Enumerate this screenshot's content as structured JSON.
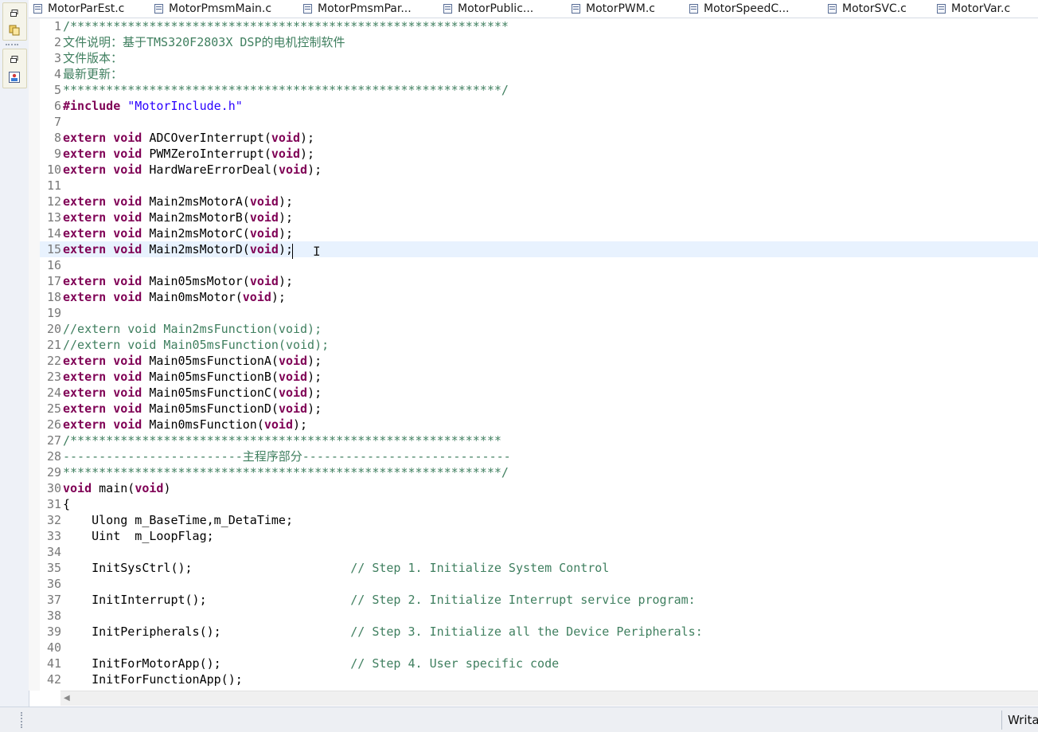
{
  "tabs": [
    {
      "label": "MotorParEst.c"
    },
    {
      "label": "MotorPmsmMain.c"
    },
    {
      "label": "MotorPmsmPar..."
    },
    {
      "label": "MotorPublic..."
    },
    {
      "label": "MotorPWM.c"
    },
    {
      "label": "MotorSpeedC..."
    },
    {
      "label": "MotorSVC.c"
    },
    {
      "label": "MotorVar.c"
    }
  ],
  "toolbar_icons": [
    "restore-icon",
    "copy-files-icon",
    "restore-icon",
    "image-icon"
  ],
  "editor": {
    "current_line": 15,
    "lines": [
      {
        "n": "1",
        "segs": [
          {
            "t": "/*************************************************************",
            "c": "cm"
          }
        ]
      },
      {
        "n": "2",
        "segs": [
          {
            "t": "文件说明：基于TMS320F2803X DSP的电机控制软件",
            "c": "cm"
          }
        ]
      },
      {
        "n": "3",
        "segs": [
          {
            "t": "文件版本：",
            "c": "cm"
          }
        ]
      },
      {
        "n": "4",
        "segs": [
          {
            "t": "最新更新：",
            "c": "cm"
          }
        ]
      },
      {
        "n": "5",
        "segs": [
          {
            "t": "*************************************************************/",
            "c": "cm"
          }
        ]
      },
      {
        "n": "6",
        "segs": [
          {
            "t": "#include",
            "c": "kw"
          },
          {
            "t": " ",
            "c": "pl"
          },
          {
            "t": "\"MotorInclude.h\"",
            "c": "str"
          }
        ]
      },
      {
        "n": "7",
        "segs": []
      },
      {
        "n": "8",
        "segs": [
          {
            "t": "extern",
            "c": "kw"
          },
          {
            "t": " ",
            "c": "pl"
          },
          {
            "t": "void",
            "c": "kw"
          },
          {
            "t": " ADCOverInterrupt(",
            "c": "pl"
          },
          {
            "t": "void",
            "c": "kw"
          },
          {
            "t": ");",
            "c": "pl"
          }
        ]
      },
      {
        "n": "9",
        "segs": [
          {
            "t": "extern",
            "c": "kw"
          },
          {
            "t": " ",
            "c": "pl"
          },
          {
            "t": "void",
            "c": "kw"
          },
          {
            "t": " PWMZeroInterrupt(",
            "c": "pl"
          },
          {
            "t": "void",
            "c": "kw"
          },
          {
            "t": ");",
            "c": "pl"
          }
        ]
      },
      {
        "n": "10",
        "segs": [
          {
            "t": "extern",
            "c": "kw"
          },
          {
            "t": " ",
            "c": "pl"
          },
          {
            "t": "void",
            "c": "kw"
          },
          {
            "t": " HardWareErrorDeal(",
            "c": "pl"
          },
          {
            "t": "void",
            "c": "kw"
          },
          {
            "t": ");",
            "c": "pl"
          }
        ]
      },
      {
        "n": "11",
        "segs": []
      },
      {
        "n": "12",
        "segs": [
          {
            "t": "extern",
            "c": "kw"
          },
          {
            "t": " ",
            "c": "pl"
          },
          {
            "t": "void",
            "c": "kw"
          },
          {
            "t": " Main2msMotorA(",
            "c": "pl"
          },
          {
            "t": "void",
            "c": "kw"
          },
          {
            "t": ");",
            "c": "pl"
          }
        ]
      },
      {
        "n": "13",
        "segs": [
          {
            "t": "extern",
            "c": "kw"
          },
          {
            "t": " ",
            "c": "pl"
          },
          {
            "t": "void",
            "c": "kw"
          },
          {
            "t": " Main2msMotorB(",
            "c": "pl"
          },
          {
            "t": "void",
            "c": "kw"
          },
          {
            "t": ");",
            "c": "pl"
          }
        ]
      },
      {
        "n": "14",
        "segs": [
          {
            "t": "extern",
            "c": "kw"
          },
          {
            "t": " ",
            "c": "pl"
          },
          {
            "t": "void",
            "c": "kw"
          },
          {
            "t": " Main2msMotorC(",
            "c": "pl"
          },
          {
            "t": "void",
            "c": "kw"
          },
          {
            "t": ");",
            "c": "pl"
          }
        ]
      },
      {
        "n": "15",
        "segs": [
          {
            "t": "extern",
            "c": "kw"
          },
          {
            "t": " ",
            "c": "pl"
          },
          {
            "t": "void",
            "c": "kw"
          },
          {
            "t": " Main2msMotorD(",
            "c": "pl"
          },
          {
            "t": "void",
            "c": "kw"
          },
          {
            "t": ");",
            "c": "pl"
          }
        ]
      },
      {
        "n": "16",
        "segs": []
      },
      {
        "n": "17",
        "segs": [
          {
            "t": "extern",
            "c": "kw"
          },
          {
            "t": " ",
            "c": "pl"
          },
          {
            "t": "void",
            "c": "kw"
          },
          {
            "t": " Main05msMotor(",
            "c": "pl"
          },
          {
            "t": "void",
            "c": "kw"
          },
          {
            "t": ");",
            "c": "pl"
          }
        ]
      },
      {
        "n": "18",
        "segs": [
          {
            "t": "extern",
            "c": "kw"
          },
          {
            "t": " ",
            "c": "pl"
          },
          {
            "t": "void",
            "c": "kw"
          },
          {
            "t": " Main0msMotor(",
            "c": "pl"
          },
          {
            "t": "void",
            "c": "kw"
          },
          {
            "t": ");",
            "c": "pl"
          }
        ]
      },
      {
        "n": "19",
        "segs": []
      },
      {
        "n": "20",
        "segs": [
          {
            "t": "//extern void Main2msFunction(void);",
            "c": "cm"
          }
        ]
      },
      {
        "n": "21",
        "segs": [
          {
            "t": "//extern void Main05msFunction(void);",
            "c": "cm"
          }
        ]
      },
      {
        "n": "22",
        "segs": [
          {
            "t": "extern",
            "c": "kw"
          },
          {
            "t": " ",
            "c": "pl"
          },
          {
            "t": "void",
            "c": "kw"
          },
          {
            "t": " Main05msFunctionA(",
            "c": "pl"
          },
          {
            "t": "void",
            "c": "kw"
          },
          {
            "t": ");",
            "c": "pl"
          }
        ]
      },
      {
        "n": "23",
        "segs": [
          {
            "t": "extern",
            "c": "kw"
          },
          {
            "t": " ",
            "c": "pl"
          },
          {
            "t": "void",
            "c": "kw"
          },
          {
            "t": " Main05msFunctionB(",
            "c": "pl"
          },
          {
            "t": "void",
            "c": "kw"
          },
          {
            "t": ");",
            "c": "pl"
          }
        ]
      },
      {
        "n": "24",
        "segs": [
          {
            "t": "extern",
            "c": "kw"
          },
          {
            "t": " ",
            "c": "pl"
          },
          {
            "t": "void",
            "c": "kw"
          },
          {
            "t": " Main05msFunctionC(",
            "c": "pl"
          },
          {
            "t": "void",
            "c": "kw"
          },
          {
            "t": ");",
            "c": "pl"
          }
        ]
      },
      {
        "n": "25",
        "segs": [
          {
            "t": "extern",
            "c": "kw"
          },
          {
            "t": " ",
            "c": "pl"
          },
          {
            "t": "void",
            "c": "kw"
          },
          {
            "t": " Main05msFunctionD(",
            "c": "pl"
          },
          {
            "t": "void",
            "c": "kw"
          },
          {
            "t": ");",
            "c": "pl"
          }
        ]
      },
      {
        "n": "26",
        "segs": [
          {
            "t": "extern",
            "c": "kw"
          },
          {
            "t": " ",
            "c": "pl"
          },
          {
            "t": "void",
            "c": "kw"
          },
          {
            "t": " Main0msFunction(",
            "c": "pl"
          },
          {
            "t": "void",
            "c": "kw"
          },
          {
            "t": ");",
            "c": "pl"
          }
        ]
      },
      {
        "n": "27",
        "segs": [
          {
            "t": "/************************************************************",
            "c": "cm"
          }
        ]
      },
      {
        "n": "28",
        "segs": [
          {
            "t": "-------------------------主程序部分-----------------------------",
            "c": "cm"
          }
        ]
      },
      {
        "n": "29",
        "segs": [
          {
            "t": "*************************************************************/",
            "c": "cm"
          }
        ]
      },
      {
        "n": "30",
        "segs": [
          {
            "t": "void",
            "c": "kw"
          },
          {
            "t": " main(",
            "c": "pl"
          },
          {
            "t": "void",
            "c": "kw"
          },
          {
            "t": ")",
            "c": "pl"
          }
        ]
      },
      {
        "n": "31",
        "segs": [
          {
            "t": "{",
            "c": "pl"
          }
        ]
      },
      {
        "n": "32",
        "segs": [
          {
            "t": "    Ulong m_BaseTime,m_DetaTime;",
            "c": "pl"
          }
        ]
      },
      {
        "n": "33",
        "segs": [
          {
            "t": "    Uint  m_LoopFlag;",
            "c": "pl"
          }
        ]
      },
      {
        "n": "34",
        "segs": []
      },
      {
        "n": "35",
        "segs": [
          {
            "t": "    InitSysCtrl();                      ",
            "c": "pl"
          },
          {
            "t": "// Step 1. Initialize System Control",
            "c": "cm"
          }
        ]
      },
      {
        "n": "36",
        "segs": []
      },
      {
        "n": "37",
        "segs": [
          {
            "t": "    InitInterrupt();                    ",
            "c": "pl"
          },
          {
            "t": "// Step 2. Initialize Interrupt service program:",
            "c": "cm"
          }
        ]
      },
      {
        "n": "38",
        "segs": []
      },
      {
        "n": "39",
        "segs": [
          {
            "t": "    InitPeripherals();                  ",
            "c": "pl"
          },
          {
            "t": "// Step 3. Initialize all the Device Peripherals:",
            "c": "cm"
          }
        ]
      },
      {
        "n": "40",
        "segs": []
      },
      {
        "n": "41",
        "segs": [
          {
            "t": "    InitForMotorApp();                  ",
            "c": "pl"
          },
          {
            "t": "// Step 4. User specific code",
            "c": "cm"
          }
        ]
      },
      {
        "n": "42",
        "segs": [
          {
            "t": "    InitForFunctionApp();",
            "c": "pl"
          }
        ]
      }
    ]
  },
  "statusbar": {
    "mode": "Writable"
  },
  "colors": {
    "keyword": "#7f0055",
    "string": "#2a00ff",
    "comment": "#3f7f5f",
    "current_line": "#e8f2fe",
    "line_number": "#787878"
  }
}
